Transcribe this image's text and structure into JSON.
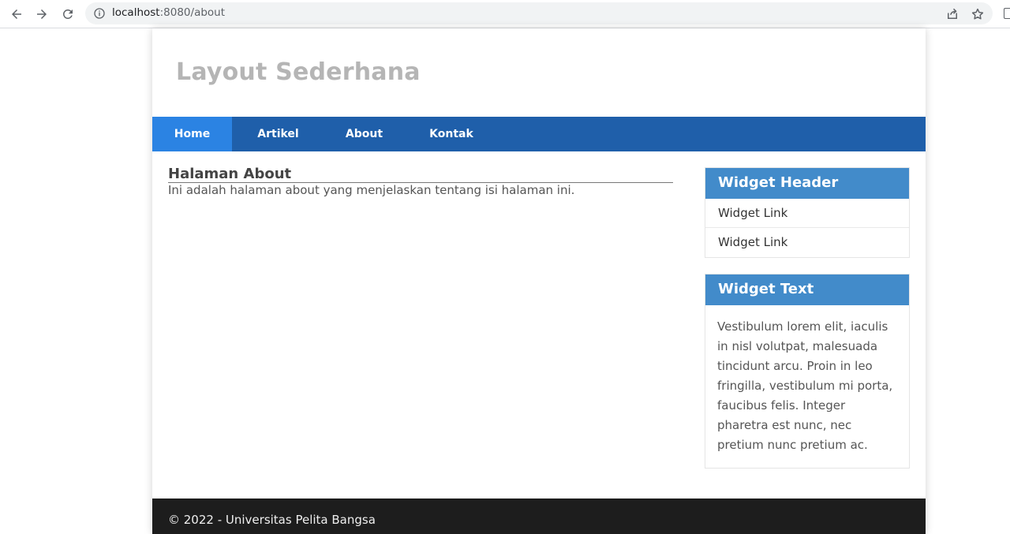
{
  "browser": {
    "url_host": "localhost",
    "url_path": ":8080/about",
    "icons": [
      "back-icon",
      "forward-icon",
      "reload-icon",
      "info-icon",
      "share-icon",
      "star-icon"
    ]
  },
  "site": {
    "title": "Layout Sederhana"
  },
  "nav": {
    "items": [
      {
        "label": "Home",
        "active": true
      },
      {
        "label": "Artikel",
        "active": false
      },
      {
        "label": "About",
        "active": false
      },
      {
        "label": "Kontak",
        "active": false
      }
    ]
  },
  "content": {
    "heading": "Halaman About",
    "text": "Ini adalah halaman about yang menjelaskan tentang isi halaman ini."
  },
  "sidebar": {
    "widget_header": {
      "title": "Widget Header",
      "links": [
        "Widget Link",
        "Widget Link"
      ]
    },
    "widget_text": {
      "title": "Widget Text",
      "body": "Vestibulum lorem elit, iaculis in nisl volutpat, malesuada tincidunt arcu. Proin in leo fringilla, vestibulum mi porta, faucibus felis. Integer pharetra est nunc, nec pretium nunc pretium ac."
    }
  },
  "footer": {
    "text": "© 2022 - Universitas Pelita Bangsa"
  },
  "colors": {
    "nav_bg": "#1f5faa",
    "nav_active": "#2b83e3",
    "widget_header_bg": "#428bca",
    "footer_bg": "#1d1d1d",
    "site_title": "#b5b5b5"
  }
}
